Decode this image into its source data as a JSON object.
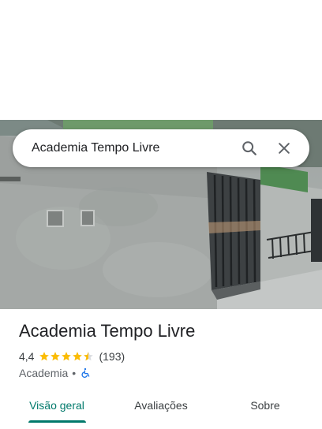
{
  "search": {
    "query": "Academia Tempo Livre",
    "search_icon": "search-icon",
    "close_icon": "close-icon"
  },
  "place": {
    "name": "Academia Tempo Livre",
    "rating": "4,4",
    "stars": 4.4,
    "reviews": "(193)",
    "category": "Academia",
    "separator": "•",
    "accessibility_icon": "wheelchair-icon",
    "star_color": "#fbbc04",
    "accessibility_color": "#1a73e8"
  },
  "tabs": [
    {
      "label": "Visão geral",
      "active": true
    },
    {
      "label": "Avaliações",
      "active": false
    },
    {
      "label": "Sobre",
      "active": false
    }
  ],
  "colors": {
    "accent": "#00796b"
  }
}
